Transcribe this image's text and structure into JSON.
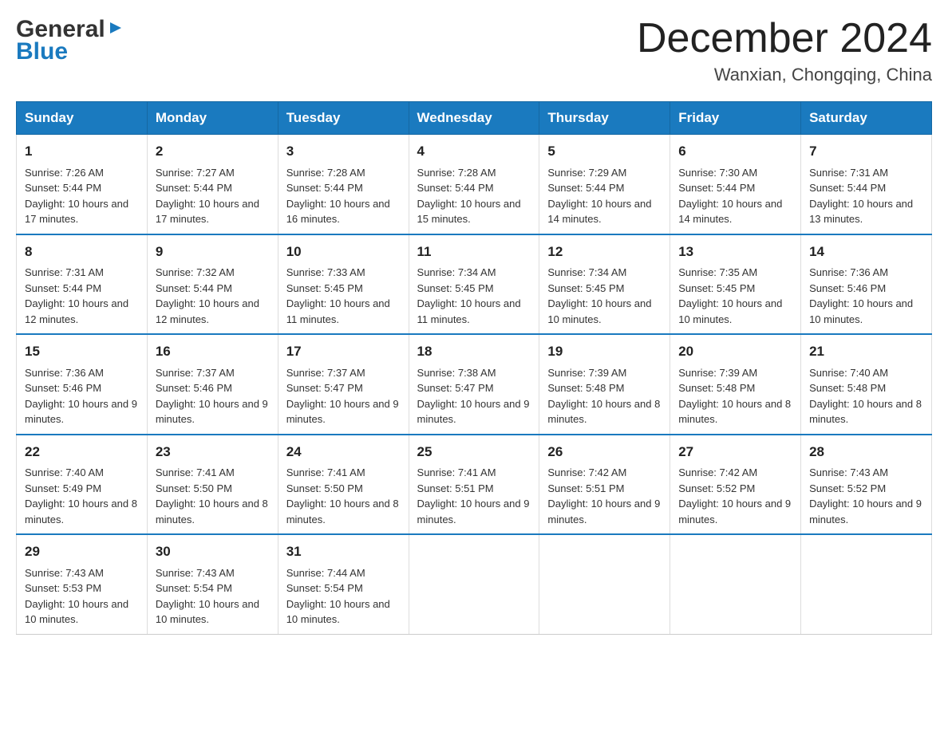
{
  "header": {
    "logo_general": "General",
    "logo_blue": "Blue",
    "month_title": "December 2024",
    "location": "Wanxian, Chongqing, China"
  },
  "weekdays": [
    "Sunday",
    "Monday",
    "Tuesday",
    "Wednesday",
    "Thursday",
    "Friday",
    "Saturday"
  ],
  "weeks": [
    [
      {
        "day": "1",
        "sunrise": "7:26 AM",
        "sunset": "5:44 PM",
        "daylight": "10 hours and 17 minutes."
      },
      {
        "day": "2",
        "sunrise": "7:27 AM",
        "sunset": "5:44 PM",
        "daylight": "10 hours and 17 minutes."
      },
      {
        "day": "3",
        "sunrise": "7:28 AM",
        "sunset": "5:44 PM",
        "daylight": "10 hours and 16 minutes."
      },
      {
        "day": "4",
        "sunrise": "7:28 AM",
        "sunset": "5:44 PM",
        "daylight": "10 hours and 15 minutes."
      },
      {
        "day": "5",
        "sunrise": "7:29 AM",
        "sunset": "5:44 PM",
        "daylight": "10 hours and 14 minutes."
      },
      {
        "day": "6",
        "sunrise": "7:30 AM",
        "sunset": "5:44 PM",
        "daylight": "10 hours and 14 minutes."
      },
      {
        "day": "7",
        "sunrise": "7:31 AM",
        "sunset": "5:44 PM",
        "daylight": "10 hours and 13 minutes."
      }
    ],
    [
      {
        "day": "8",
        "sunrise": "7:31 AM",
        "sunset": "5:44 PM",
        "daylight": "10 hours and 12 minutes."
      },
      {
        "day": "9",
        "sunrise": "7:32 AM",
        "sunset": "5:44 PM",
        "daylight": "10 hours and 12 minutes."
      },
      {
        "day": "10",
        "sunrise": "7:33 AM",
        "sunset": "5:45 PM",
        "daylight": "10 hours and 11 minutes."
      },
      {
        "day": "11",
        "sunrise": "7:34 AM",
        "sunset": "5:45 PM",
        "daylight": "10 hours and 11 minutes."
      },
      {
        "day": "12",
        "sunrise": "7:34 AM",
        "sunset": "5:45 PM",
        "daylight": "10 hours and 10 minutes."
      },
      {
        "day": "13",
        "sunrise": "7:35 AM",
        "sunset": "5:45 PM",
        "daylight": "10 hours and 10 minutes."
      },
      {
        "day": "14",
        "sunrise": "7:36 AM",
        "sunset": "5:46 PM",
        "daylight": "10 hours and 10 minutes."
      }
    ],
    [
      {
        "day": "15",
        "sunrise": "7:36 AM",
        "sunset": "5:46 PM",
        "daylight": "10 hours and 9 minutes."
      },
      {
        "day": "16",
        "sunrise": "7:37 AM",
        "sunset": "5:46 PM",
        "daylight": "10 hours and 9 minutes."
      },
      {
        "day": "17",
        "sunrise": "7:37 AM",
        "sunset": "5:47 PM",
        "daylight": "10 hours and 9 minutes."
      },
      {
        "day": "18",
        "sunrise": "7:38 AM",
        "sunset": "5:47 PM",
        "daylight": "10 hours and 9 minutes."
      },
      {
        "day": "19",
        "sunrise": "7:39 AM",
        "sunset": "5:48 PM",
        "daylight": "10 hours and 8 minutes."
      },
      {
        "day": "20",
        "sunrise": "7:39 AM",
        "sunset": "5:48 PM",
        "daylight": "10 hours and 8 minutes."
      },
      {
        "day": "21",
        "sunrise": "7:40 AM",
        "sunset": "5:48 PM",
        "daylight": "10 hours and 8 minutes."
      }
    ],
    [
      {
        "day": "22",
        "sunrise": "7:40 AM",
        "sunset": "5:49 PM",
        "daylight": "10 hours and 8 minutes."
      },
      {
        "day": "23",
        "sunrise": "7:41 AM",
        "sunset": "5:50 PM",
        "daylight": "10 hours and 8 minutes."
      },
      {
        "day": "24",
        "sunrise": "7:41 AM",
        "sunset": "5:50 PM",
        "daylight": "10 hours and 8 minutes."
      },
      {
        "day": "25",
        "sunrise": "7:41 AM",
        "sunset": "5:51 PM",
        "daylight": "10 hours and 9 minutes."
      },
      {
        "day": "26",
        "sunrise": "7:42 AM",
        "sunset": "5:51 PM",
        "daylight": "10 hours and 9 minutes."
      },
      {
        "day": "27",
        "sunrise": "7:42 AM",
        "sunset": "5:52 PM",
        "daylight": "10 hours and 9 minutes."
      },
      {
        "day": "28",
        "sunrise": "7:43 AM",
        "sunset": "5:52 PM",
        "daylight": "10 hours and 9 minutes."
      }
    ],
    [
      {
        "day": "29",
        "sunrise": "7:43 AM",
        "sunset": "5:53 PM",
        "daylight": "10 hours and 10 minutes."
      },
      {
        "day": "30",
        "sunrise": "7:43 AM",
        "sunset": "5:54 PM",
        "daylight": "10 hours and 10 minutes."
      },
      {
        "day": "31",
        "sunrise": "7:44 AM",
        "sunset": "5:54 PM",
        "daylight": "10 hours and 10 minutes."
      },
      null,
      null,
      null,
      null
    ]
  ]
}
